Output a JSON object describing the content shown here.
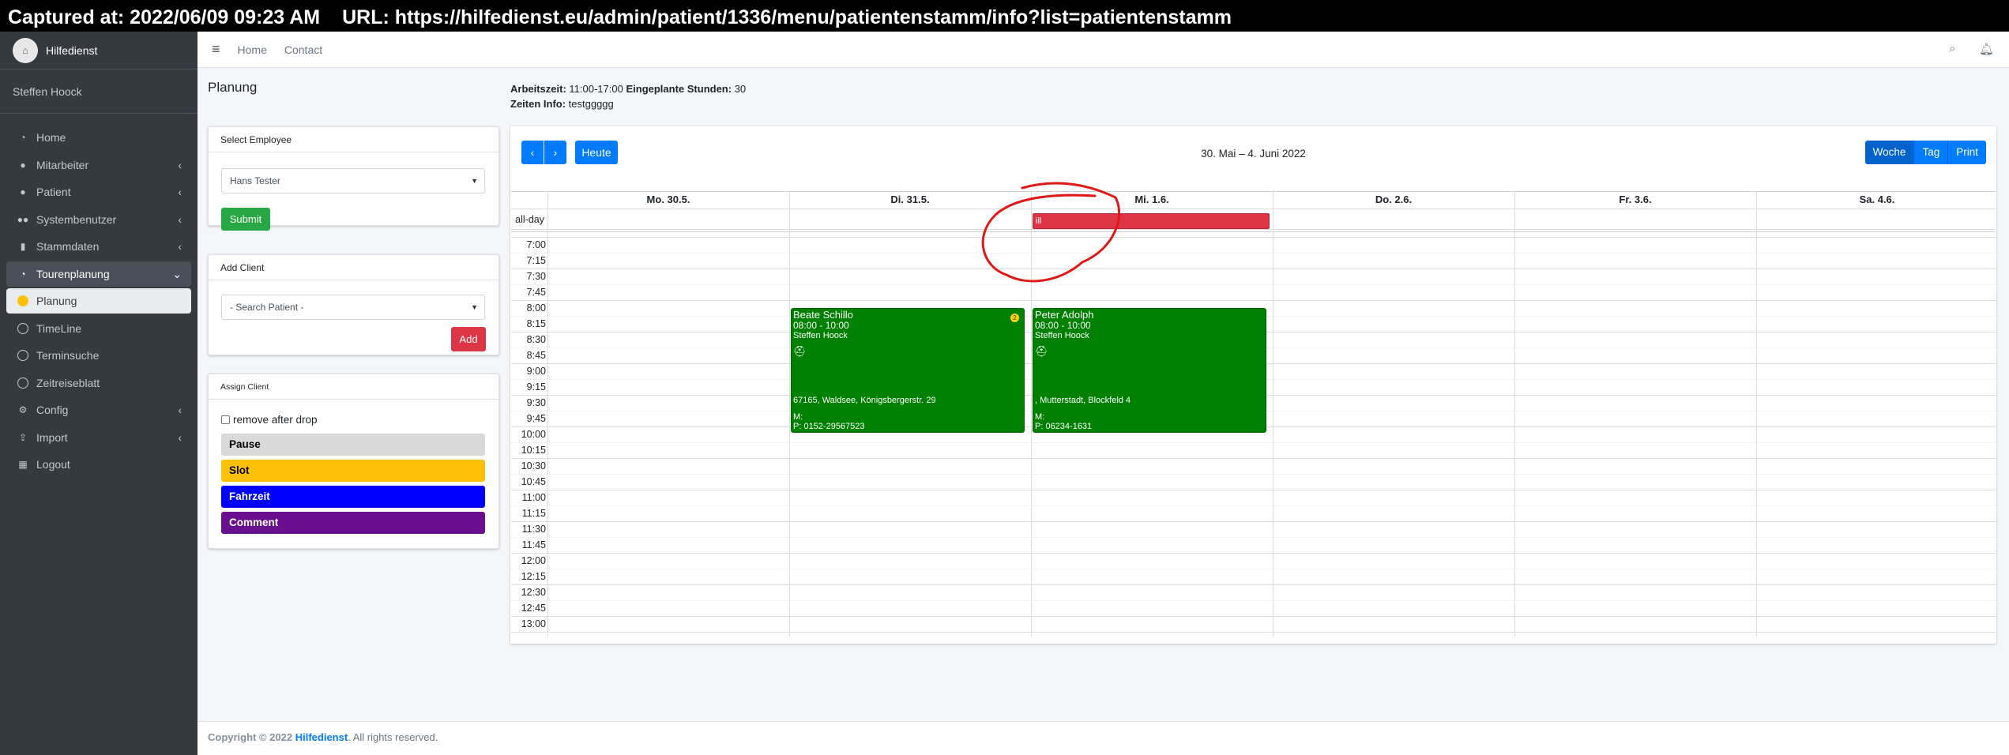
{
  "capture": {
    "captured": "Captured at: 2022/06/09 09:23 AM",
    "url": "URL: https://hilfedienst.eu/admin/patient/1336/menu/patientenstamm/info?list=patientenstamm"
  },
  "brand": {
    "name": "Hilfedienst"
  },
  "user": {
    "name": "Steffen Hoock"
  },
  "sidebar": {
    "items": [
      {
        "label": "Home",
        "icon": "dashboard-icon"
      },
      {
        "label": "Mitarbeiter",
        "icon": "user-icon"
      },
      {
        "label": "Patient",
        "icon": "user-icon"
      },
      {
        "label": "Systembenutzer",
        "icon": "users-icon"
      },
      {
        "label": "Stammdaten",
        "icon": "book-icon"
      },
      {
        "label": "Tourenplanung",
        "icon": "gauge-icon"
      },
      {
        "label": "Planung",
        "icon": "circle-icon"
      },
      {
        "label": "TimeLine",
        "icon": "circle-outline-icon"
      },
      {
        "label": "Terminsuche",
        "icon": "circle-outline-icon"
      },
      {
        "label": "Zeitreiseblatt",
        "icon": "circle-outline-icon"
      },
      {
        "label": "Config",
        "icon": "gear-icon"
      },
      {
        "label": "Import",
        "icon": "upload-icon"
      },
      {
        "label": "Logout",
        "icon": "building-icon"
      }
    ]
  },
  "topnav": {
    "home": "Home",
    "contact": "Contact"
  },
  "page": {
    "title": "Planung"
  },
  "info": {
    "arbeitszeit_label": "Arbeitszeit:",
    "arbeitszeit_value": " 11:00-17:00",
    "stunden_label": "Eingeplante Stunden:",
    "stunden_value": " 30",
    "zeiten_label": "Zeiten Info:",
    "zeiten_value": " testggggg"
  },
  "select_employee": {
    "header": "Select Employee",
    "value": "Hans Tester",
    "submit": "Submit"
  },
  "add_client": {
    "header": "Add Client",
    "placeholder": "- Search Patient -",
    "add": "Add"
  },
  "assign_client": {
    "header": "Assign Client",
    "remove_label": "remove after drop",
    "chips": [
      {
        "label": "Pause",
        "bg": "#d9d9d9",
        "fg": "#000000"
      },
      {
        "label": "Slot",
        "bg": "#ffc107",
        "fg": "#000000"
      },
      {
        "label": "Fahrzeit",
        "bg": "#0000ff",
        "fg": "#ffffff"
      },
      {
        "label": "Comment",
        "bg": "#6a0f8e",
        "fg": "#ffffff"
      }
    ]
  },
  "calendar": {
    "today": "Heute",
    "range": "30. Mai – 4. Juni 2022",
    "views": [
      "Woche",
      "Tag",
      "Print"
    ],
    "allday": "all-day",
    "days": [
      "Mo. 30.5.",
      "Di. 31.5.",
      "Mi. 1.6.",
      "Do. 2.6.",
      "Fr. 3.6.",
      "Sa. 4.6."
    ],
    "times": [
      "7:00",
      "7:15",
      "7:30",
      "7:45",
      "8:00",
      "8:15",
      "8:30",
      "8:45",
      "9:00",
      "9:15",
      "9:30",
      "9:45",
      "10:00",
      "10:15",
      "10:30",
      "10:45",
      "11:00",
      "11:15",
      "11:30",
      "11:45",
      "12:00",
      "12:15",
      "12:30",
      "12:45",
      "13:00"
    ],
    "allday_event": {
      "label": "ill",
      "color": "#dc3545"
    },
    "events": [
      {
        "name": "Beate Schillo",
        "time": "08:00 - 10:00",
        "staff": "Steffen Hoock",
        "address": "67165, Waldsee, Königsbergerstr. 29",
        "m": "M:",
        "phone": "P: 0152-29567523",
        "badge": "2"
      },
      {
        "name": "Peter Adolph",
        "time": "08:00 - 10:00",
        "staff": "Steffen Hoock",
        "address": ", Mutterstadt, Blockfeld 4",
        "m": "M:",
        "phone": "P: 06234-1631",
        "badge": ""
      }
    ]
  },
  "footer": {
    "prefix": "Copyright © 2022 ",
    "brand": "Hilfedienst",
    "suffix": ". All rights reserved."
  }
}
